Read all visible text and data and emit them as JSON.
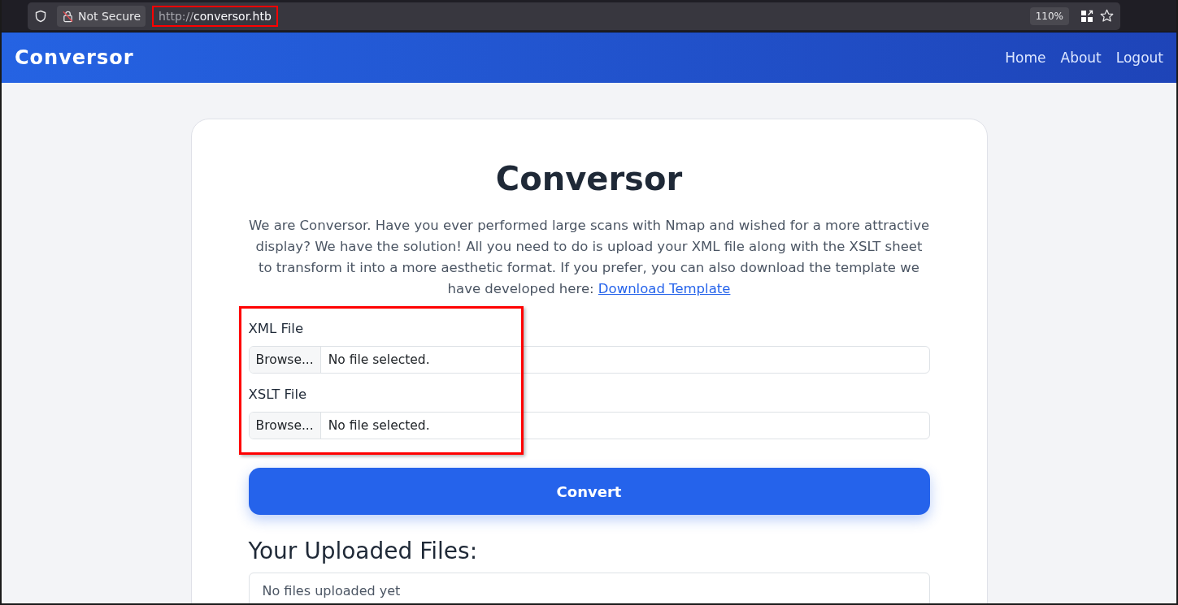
{
  "browser": {
    "security_label": "Not Secure",
    "url_scheme": "http://",
    "url_host": "conversor.htb",
    "zoom": "110%",
    "url_highlighted": true
  },
  "navbar": {
    "brand": "Conversor",
    "links": [
      {
        "label": "Home"
      },
      {
        "label": "About"
      },
      {
        "label": "Logout"
      }
    ]
  },
  "main": {
    "title": "Conversor",
    "intro": "We are Conversor. Have you ever performed large scans with Nmap and wished for a more attractive display? We have the solution! All you need to do is upload your XML file along with the XSLT sheet to transform it into a more aesthetic format. If you prefer, you can also download the template we have developed here:",
    "intro_link": "Download Template",
    "file_fields_highlighted": true,
    "file_fields": [
      {
        "label": "XML File",
        "button": "Browse...",
        "status": "No file selected."
      },
      {
        "label": "XSLT File",
        "button": "Browse...",
        "status": "No file selected."
      }
    ],
    "submit": "Convert",
    "uploads_heading": "Your Uploaded Files:",
    "uploads_empty": "No files uploaded yet"
  }
}
